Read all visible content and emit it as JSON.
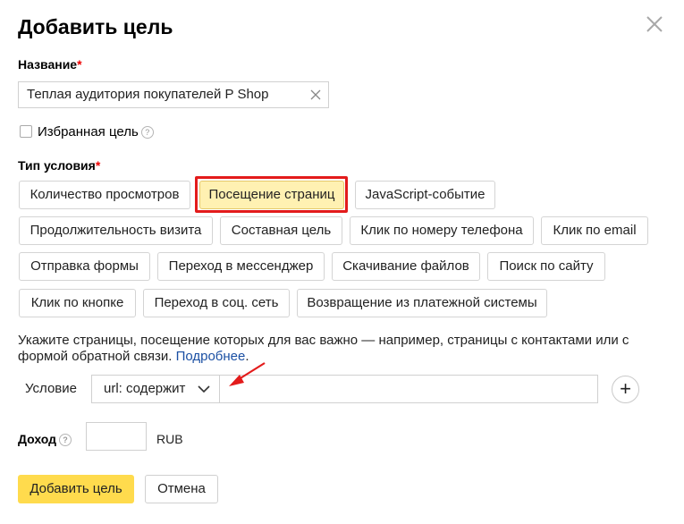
{
  "dialog": {
    "title": "Добавить цель"
  },
  "name": {
    "label": "Название",
    "required_mark": "*",
    "value": "Теплая аудитория покупателей P Shop"
  },
  "favorite": {
    "label": "Избранная цель",
    "help": "?"
  },
  "condition_type": {
    "label": "Тип условия",
    "required_mark": "*",
    "options": [
      "Количество просмотров",
      "Посещение страниц",
      "JavaScript-событие",
      "Продолжительность визита",
      "Составная цель",
      "Клик по номеру телефона",
      "Клик по email",
      "Отправка формы",
      "Переход в мессенджер",
      "Скачивание файлов",
      "Поиск по сайту",
      "Клик по кнопке",
      "Переход в соц. сеть",
      "Возвращение из платежной системы"
    ],
    "selected": "Посещение страниц"
  },
  "hint": {
    "text": "Укажите страницы, посещение которых для вас важно — например, страницы с контактами или с формой обратной связи. ",
    "link": "Подробнее",
    "tail": "."
  },
  "condition": {
    "label": "Условие",
    "operator": "url: содержит",
    "value": "",
    "add": "+"
  },
  "income": {
    "label": "Доход",
    "help": "?",
    "value": "",
    "currency": "RUB"
  },
  "actions": {
    "submit": "Добавить цель",
    "cancel": "Отмена"
  },
  "colors": {
    "accent_yellow": "#ffdb4d",
    "selected_bg": "#fff1b2",
    "highlight_red": "#e31b1b",
    "link": "#1a4fa3"
  }
}
